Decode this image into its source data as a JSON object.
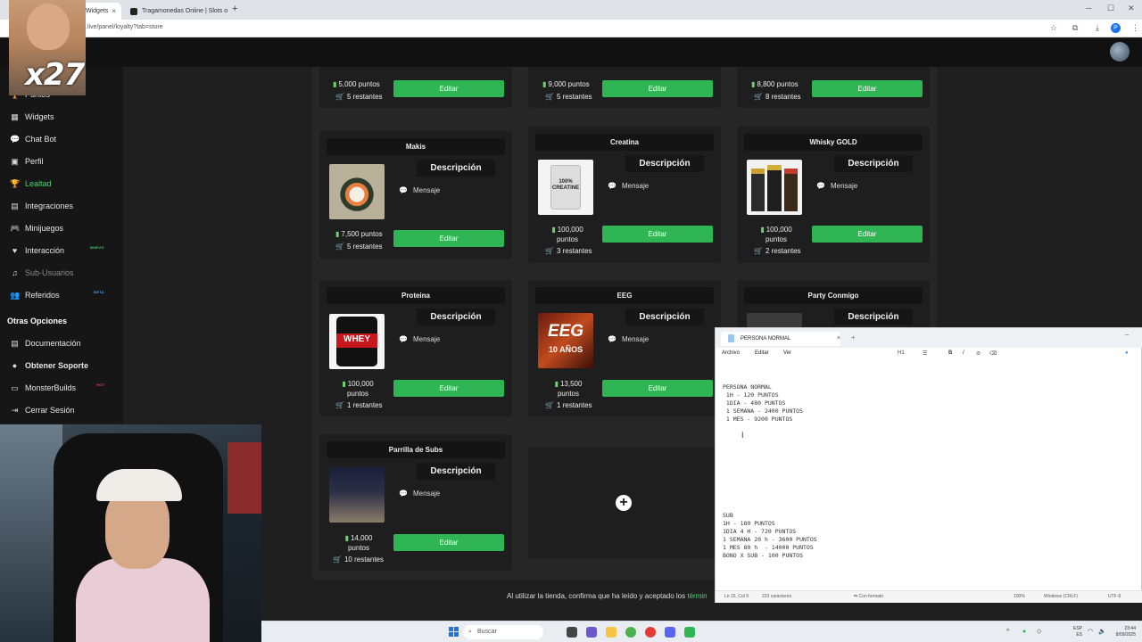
{
  "browser": {
    "tabs": [
      {
        "label": "Widgets",
        "active": true
      },
      {
        "label": "Tragamonedas Online | Slots o",
        "active": false
      }
    ],
    "url": ".live/panel/loyalty?tab=store"
  },
  "sidebar": {
    "items": [
      {
        "label": "Puntos",
        "icon": "trophy-icon",
        "glyph": "🏆"
      },
      {
        "label": "Widgets",
        "icon": "widgets-icon",
        "glyph": "▦"
      },
      {
        "label": "Chat Bot",
        "icon": "chat-icon",
        "glyph": "💬"
      },
      {
        "label": "Perfil",
        "icon": "profile-icon",
        "glyph": "▣"
      },
      {
        "label": "Lealtad",
        "icon": "trophy-icon",
        "glyph": "🏆",
        "active": true
      },
      {
        "label": "Integraciones",
        "icon": "integrations-icon",
        "glyph": "▤"
      },
      {
        "label": "Minijuegos",
        "icon": "gamepad-icon",
        "glyph": "🎮"
      },
      {
        "label": "Interacción",
        "icon": "interaction-icon",
        "glyph": "♥",
        "badge": "NUEVO"
      },
      {
        "label": "Sub-Usuarios",
        "icon": "music-icon",
        "glyph": "♫",
        "dim": true
      },
      {
        "label": "Referidos",
        "icon": "users-icon",
        "glyph": "👥",
        "badge": "BETA"
      }
    ],
    "section_title": "Otras Opciones",
    "other_items": [
      {
        "label": "Documentación",
        "icon": "document-icon",
        "glyph": "▤"
      },
      {
        "label": "Obtener Soporte",
        "icon": "support-icon",
        "glyph": "●"
      },
      {
        "label": "MonsterBuilds",
        "icon": "monitor-icon",
        "glyph": "▭",
        "badge": "HOT"
      },
      {
        "label": "Cerrar Sesión",
        "icon": "logout-icon",
        "glyph": "⇥"
      }
    ]
  },
  "store": {
    "top_row": [
      {
        "points": "5,000 puntos",
        "remaining": "5 restantes"
      },
      {
        "points": "9,000 puntos",
        "remaining": "5 restantes"
      },
      {
        "points": "8,800 puntos",
        "remaining": "8 restantes"
      }
    ],
    "cards": [
      {
        "title": "Makis",
        "description": "Descripción",
        "message": "Mensaje",
        "points": "7,500 puntos",
        "remaining": "5 restantes"
      },
      {
        "title": "Creatina",
        "description": "Descripción",
        "message": "Mensaje",
        "points": "100,000 puntos",
        "remaining": "3 restantes"
      },
      {
        "title": "Whisky GOLD",
        "description": "Descripción",
        "message": "Mensaje",
        "points": "100,000 puntos",
        "remaining": "2 restantes"
      },
      {
        "title": "Proteina",
        "description": "Descripción",
        "message": "Mensaje",
        "points": "100,000 puntos",
        "remaining": "1 restantes"
      },
      {
        "title": "EEG",
        "description": "Descripción",
        "message": "Mensaje",
        "points": "13,500 puntos",
        "remaining": "1 restantes"
      },
      {
        "title": "Party Conmigo",
        "description": "Descripción",
        "message": "",
        "points": "",
        "remaining": ""
      },
      {
        "title": "Parrilla de Subs",
        "description": "Descripción",
        "message": "Mensaje",
        "points": "14,000 puntos",
        "remaining": "10 restantes"
      }
    ],
    "edit_label": "Editar",
    "image_texts": {
      "creatina": "100% CREATINE",
      "proteina": "WHEY",
      "eeg_main": "EEG",
      "eeg_sub": "10 AÑOS"
    },
    "footer_text": "Al utilizar la tienda, confirma que ha leído y aceptado los",
    "footer_link": "términ"
  },
  "notepad": {
    "tab_title": "PERSONA NORMAL",
    "menu": [
      "Archivo",
      "Editar",
      "Ver"
    ],
    "toolbar": {
      "heading": "H1",
      "bold": "B",
      "italic": "I"
    },
    "content_normal": "PERSONA NORMAL\n 1H - 120 PUNTOS\n 1DIA - 480 PUNTOS\n 1 SEMANA - 2400 PUNTOS\n 1 MES - 9200 PUNTOS",
    "content_sub": "SUB\n1H - 180 PUNTOS\n1DIA 4 H - 720 PUNTOS\n1 SEMANA 20 h - 3600 PUNTOS\n1 MES 80 h  - 14000 PUNTOS\nBONO X SUB - 100 PUNTOS",
    "status": {
      "position": "Ln 15, Col 9",
      "chars": "223 caracteres",
      "format": "Con formato",
      "zoom": "100%",
      "line_ending": "Windows (CRLF)",
      "encoding": "UTF-8"
    }
  },
  "overlay": {
    "emote_count": "x27"
  },
  "taskbar": {
    "search_placeholder": "Buscar",
    "lang": "ESP",
    "lang2": "ES",
    "time": "23:44",
    "date": "8/09/2025"
  },
  "colors": {
    "accent_green": "#2fb554",
    "active_nav": "#4ad66d",
    "cart_blue": "#25b4e8"
  }
}
